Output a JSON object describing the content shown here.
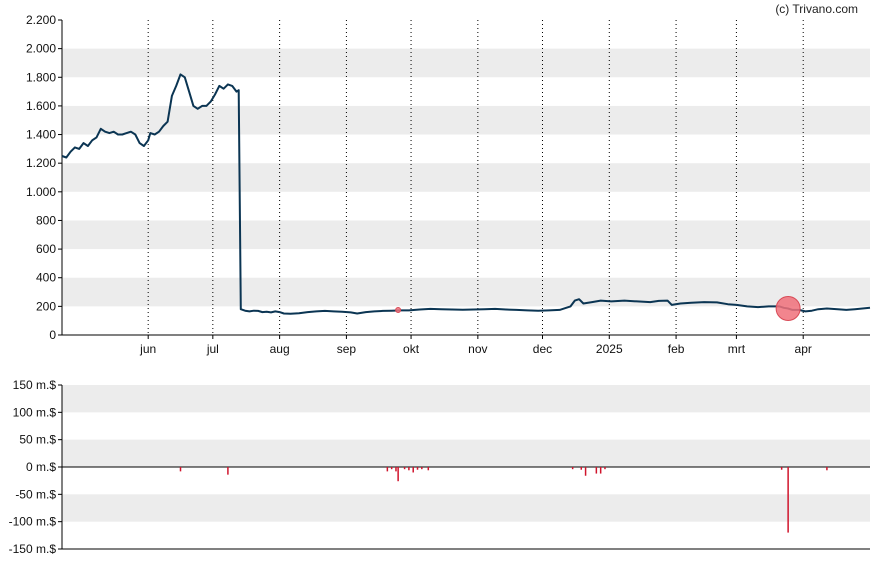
{
  "credit": "(c) Trivano.com",
  "colors": {
    "line": "#0b3553",
    "band": "#ececec",
    "marker": "#f0707a",
    "bars": "#d0142c",
    "axis": "#000000"
  },
  "chart_data": [
    {
      "type": "line",
      "title": "",
      "xlabel": "",
      "ylabel": "",
      "ylim": [
        0,
        2200
      ],
      "y_ticks": [
        0,
        200,
        400,
        600,
        800,
        1000,
        1200,
        1400,
        1600,
        1800,
        2000,
        2200
      ],
      "y_tick_labels": [
        "0",
        "200",
        "400",
        "600",
        "800",
        "1.000",
        "1.200",
        "1.400",
        "1.600",
        "1.800",
        "2.000",
        "2.200"
      ],
      "x_ticks": [
        {
          "label": "jun",
          "date": "2024-06-01"
        },
        {
          "label": "jul",
          "date": "2024-07-01"
        },
        {
          "label": "aug",
          "date": "2024-08-01"
        },
        {
          "label": "sep",
          "date": "2024-09-01"
        },
        {
          "label": "okt",
          "date": "2024-10-01"
        },
        {
          "label": "nov",
          "date": "2024-11-01"
        },
        {
          "label": "dec",
          "date": "2024-12-01"
        },
        {
          "label": "2025",
          "date": "2025-01-01"
        },
        {
          "label": "feb",
          "date": "2025-02-01"
        },
        {
          "label": "mrt",
          "date": "2025-03-01"
        },
        {
          "label": "apr",
          "date": "2025-04-01"
        }
      ],
      "xlim": [
        "2024-04-22",
        "2025-05-02"
      ],
      "grid": "vertical dotted at month ticks, alternating horizontal bands",
      "series": [
        {
          "points": [
            [
              "2024-04-22",
              1250
            ],
            [
              "2024-04-24",
              1240
            ],
            [
              "2024-04-26",
              1280
            ],
            [
              "2024-04-28",
              1310
            ],
            [
              "2024-04-30",
              1300
            ],
            [
              "2024-05-02",
              1340
            ],
            [
              "2024-05-04",
              1320
            ],
            [
              "2024-05-06",
              1360
            ],
            [
              "2024-05-08",
              1380
            ],
            [
              "2024-05-10",
              1440
            ],
            [
              "2024-05-12",
              1420
            ],
            [
              "2024-05-14",
              1410
            ],
            [
              "2024-05-16",
              1420
            ],
            [
              "2024-05-18",
              1400
            ],
            [
              "2024-05-20",
              1400
            ],
            [
              "2024-05-22",
              1410
            ],
            [
              "2024-05-24",
              1420
            ],
            [
              "2024-05-26",
              1400
            ],
            [
              "2024-05-28",
              1340
            ],
            [
              "2024-05-30",
              1320
            ],
            [
              "2024-06-01",
              1360
            ],
            [
              "2024-06-02",
              1410
            ],
            [
              "2024-06-04",
              1400
            ],
            [
              "2024-06-06",
              1420
            ],
            [
              "2024-06-08",
              1460
            ],
            [
              "2024-06-10",
              1490
            ],
            [
              "2024-06-12",
              1670
            ],
            [
              "2024-06-14",
              1740
            ],
            [
              "2024-06-16",
              1820
            ],
            [
              "2024-06-18",
              1800
            ],
            [
              "2024-06-20",
              1700
            ],
            [
              "2024-06-22",
              1600
            ],
            [
              "2024-06-24",
              1580
            ],
            [
              "2024-06-26",
              1600
            ],
            [
              "2024-06-28",
              1600
            ],
            [
              "2024-06-30",
              1630
            ],
            [
              "2024-07-02",
              1680
            ],
            [
              "2024-07-04",
              1740
            ],
            [
              "2024-07-06",
              1720
            ],
            [
              "2024-07-08",
              1750
            ],
            [
              "2024-07-10",
              1740
            ],
            [
              "2024-07-12",
              1700
            ],
            [
              "2024-07-13",
              1710
            ],
            [
              "2024-07-14",
              180
            ],
            [
              "2024-07-16",
              170
            ],
            [
              "2024-07-18",
              165
            ],
            [
              "2024-07-20",
              170
            ],
            [
              "2024-07-22",
              168
            ],
            [
              "2024-07-24",
              160
            ],
            [
              "2024-07-26",
              162
            ],
            [
              "2024-07-28",
              158
            ],
            [
              "2024-07-30",
              165
            ],
            [
              "2024-08-01",
              160
            ],
            [
              "2024-08-03",
              150
            ],
            [
              "2024-08-06",
              148
            ],
            [
              "2024-08-10",
              152
            ],
            [
              "2024-08-14",
              160
            ],
            [
              "2024-08-18",
              165
            ],
            [
              "2024-08-22",
              168
            ],
            [
              "2024-08-26",
              165
            ],
            [
              "2024-08-30",
              162
            ],
            [
              "2024-09-03",
              158
            ],
            [
              "2024-09-06",
              150
            ],
            [
              "2024-09-10",
              160
            ],
            [
              "2024-09-14",
              165
            ],
            [
              "2024-09-18",
              168
            ],
            [
              "2024-09-22",
              170
            ],
            [
              "2024-09-26",
              172
            ],
            [
              "2024-09-30",
              172
            ],
            [
              "2024-10-05",
              178
            ],
            [
              "2024-10-10",
              182
            ],
            [
              "2024-10-15",
              180
            ],
            [
              "2024-10-20",
              178
            ],
            [
              "2024-10-25",
              176
            ],
            [
              "2024-10-30",
              178
            ],
            [
              "2024-11-04",
              180
            ],
            [
              "2024-11-09",
              182
            ],
            [
              "2024-11-14",
              178
            ],
            [
              "2024-11-19",
              175
            ],
            [
              "2024-11-24",
              172
            ],
            [
              "2024-11-29",
              170
            ],
            [
              "2024-12-04",
              172
            ],
            [
              "2024-12-09",
              175
            ],
            [
              "2024-12-12",
              190
            ],
            [
              "2024-12-14",
              200
            ],
            [
              "2024-12-16",
              240
            ],
            [
              "2024-12-18",
              250
            ],
            [
              "2024-12-20",
              220
            ],
            [
              "2024-12-24",
              230
            ],
            [
              "2024-12-28",
              240
            ],
            [
              "2025-01-02",
              235
            ],
            [
              "2025-01-08",
              240
            ],
            [
              "2025-01-14",
              235
            ],
            [
              "2025-01-20",
              230
            ],
            [
              "2025-01-24",
              238
            ],
            [
              "2025-01-28",
              240
            ],
            [
              "2025-01-30",
              210
            ],
            [
              "2025-02-03",
              220
            ],
            [
              "2025-02-08",
              225
            ],
            [
              "2025-02-14",
              230
            ],
            [
              "2025-02-20",
              228
            ],
            [
              "2025-02-25",
              215
            ],
            [
              "2025-03-01",
              210
            ],
            [
              "2025-03-06",
              200
            ],
            [
              "2025-03-11",
              195
            ],
            [
              "2025-03-16",
              200
            ],
            [
              "2025-03-21",
              200
            ],
            [
              "2025-03-23",
              190
            ],
            [
              "2025-03-25",
              185
            ],
            [
              "2025-03-27",
              175
            ],
            [
              "2025-03-30",
              175
            ],
            [
              "2025-04-02",
              165
            ],
            [
              "2025-04-05",
              170
            ],
            [
              "2025-04-08",
              180
            ],
            [
              "2025-04-12",
              185
            ],
            [
              "2025-04-17",
              180
            ],
            [
              "2025-04-21",
              175
            ],
            [
              "2025-04-25",
              180
            ],
            [
              "2025-05-02",
              190
            ]
          ]
        }
      ],
      "markers": [
        {
          "date": "2024-09-25",
          "value": 175,
          "size": "small"
        },
        {
          "date": "2025-03-25",
          "value": 185,
          "size": "large"
        }
      ]
    },
    {
      "type": "bar",
      "title": "",
      "ylim": [
        -150,
        150
      ],
      "y_ticks": [
        -150,
        -100,
        -50,
        0,
        50,
        100,
        150
      ],
      "y_tick_labels": [
        "-150 m.$",
        "-100 m.$",
        "-50 m.$",
        "0 m.$",
        "50 m.$",
        "100 m.$",
        "150 m.$"
      ],
      "bars": [
        [
          "2024-06-16",
          -8
        ],
        [
          "2024-07-08",
          -14
        ],
        [
          "2024-09-20",
          -8
        ],
        [
          "2024-09-22",
          -4
        ],
        [
          "2024-09-24",
          -8
        ],
        [
          "2024-09-25",
          -26
        ],
        [
          "2024-09-28",
          -4
        ],
        [
          "2024-09-30",
          -6
        ],
        [
          "2024-10-02",
          -10
        ],
        [
          "2024-10-04",
          -5
        ],
        [
          "2024-10-06",
          -4
        ],
        [
          "2024-10-09",
          -6
        ],
        [
          "2024-12-15",
          -4
        ],
        [
          "2024-12-19",
          -5
        ],
        [
          "2024-12-21",
          -16
        ],
        [
          "2024-12-26",
          -12
        ],
        [
          "2024-12-28",
          -12
        ],
        [
          "2024-12-30",
          -4
        ],
        [
          "2025-03-22",
          -5
        ],
        [
          "2025-03-25",
          -120
        ],
        [
          "2025-04-12",
          -6
        ]
      ]
    }
  ]
}
